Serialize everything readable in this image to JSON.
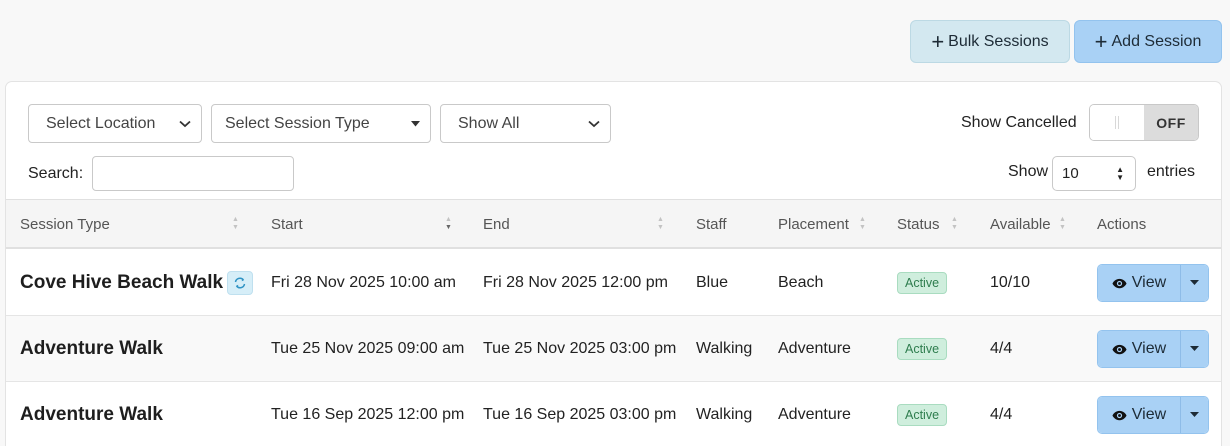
{
  "toolbar": {
    "bulk_label": "Bulk Sessions",
    "add_label": "Add Session"
  },
  "filters": {
    "location": "Select Location",
    "session_type": "Select Session Type",
    "show": "Show All",
    "show_cancelled_label": "Show Cancelled",
    "toggle_state": "OFF",
    "search_label": "Search:",
    "search_value": "",
    "show_label": "Show",
    "entries_value": "10",
    "entries_label": "entries"
  },
  "table": {
    "columns": [
      "Session Type",
      "Start",
      "End",
      "Staff",
      "Placement",
      "Status",
      "Available",
      "Actions"
    ],
    "rows": [
      {
        "session_type": "Cove Hive Beach Walk",
        "recurring": true,
        "start": "Fri 28 Nov 2025 10:00 am",
        "end": "Fri 28 Nov 2025 12:00 pm",
        "staff": "Blue",
        "placement": "Beach",
        "status": "Active",
        "available": "10/10",
        "action": "View"
      },
      {
        "session_type": "Adventure Walk",
        "recurring": false,
        "start": "Tue 25 Nov 2025 09:00 am",
        "end": "Tue 25 Nov 2025 03:00 pm",
        "staff": "Walking",
        "placement": "Adventure",
        "status": "Active",
        "available": "4/4",
        "action": "View"
      },
      {
        "session_type": "Adventure Walk",
        "recurring": false,
        "start": "Tue 16 Sep 2025 12:00 pm",
        "end": "Tue 16 Sep 2025 03:00 pm",
        "staff": "Walking",
        "placement": "Adventure",
        "status": "Active",
        "available": "4/4",
        "action": "View"
      }
    ]
  },
  "colors": {
    "primary_button": "#a9d1f5",
    "secondary_button": "#d3e8f0",
    "status_active_bg": "#cfeedd",
    "status_active_text": "#2e7d4e"
  }
}
